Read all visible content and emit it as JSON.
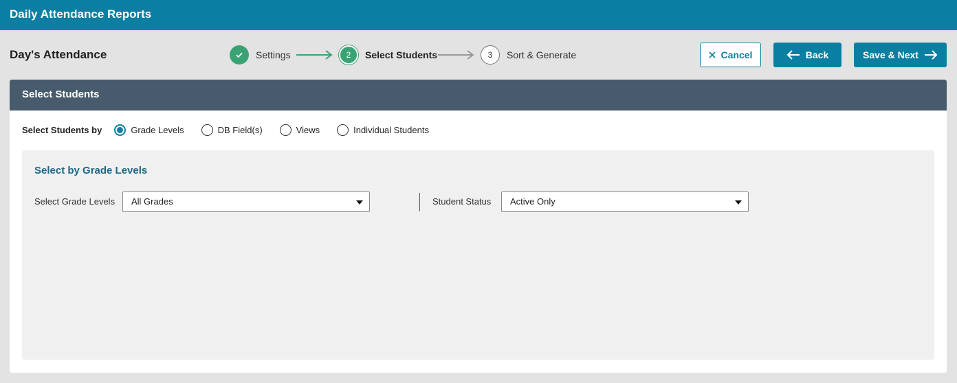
{
  "app": {
    "title": "Daily Attendance Reports"
  },
  "page": {
    "title": "Day's Attendance"
  },
  "wizard": {
    "steps": [
      {
        "number": "1",
        "label": "Settings",
        "state": "complete"
      },
      {
        "number": "2",
        "label": "Select Students",
        "state": "active"
      },
      {
        "number": "3",
        "label": "Sort & Generate",
        "state": "pending"
      }
    ]
  },
  "actions": {
    "cancel": "Cancel",
    "back": "Back",
    "save_next": "Save & Next"
  },
  "card": {
    "title": "Select Students",
    "select_by_label": "Select Students by",
    "options": [
      "Grade Levels",
      "DB Field(s)",
      "Views",
      "Individual Students"
    ],
    "selected_option": "Grade Levels",
    "section_heading": "Select by Grade Levels",
    "grade_levels": {
      "label": "Select Grade Levels",
      "value": "All Grades"
    },
    "student_status": {
      "label": "Student Status",
      "value": "Active Only"
    }
  },
  "colors": {
    "brand": "#0a7fa1",
    "complete": "#3aa374",
    "card_header": "#485b6c",
    "heading": "#1f6782"
  }
}
